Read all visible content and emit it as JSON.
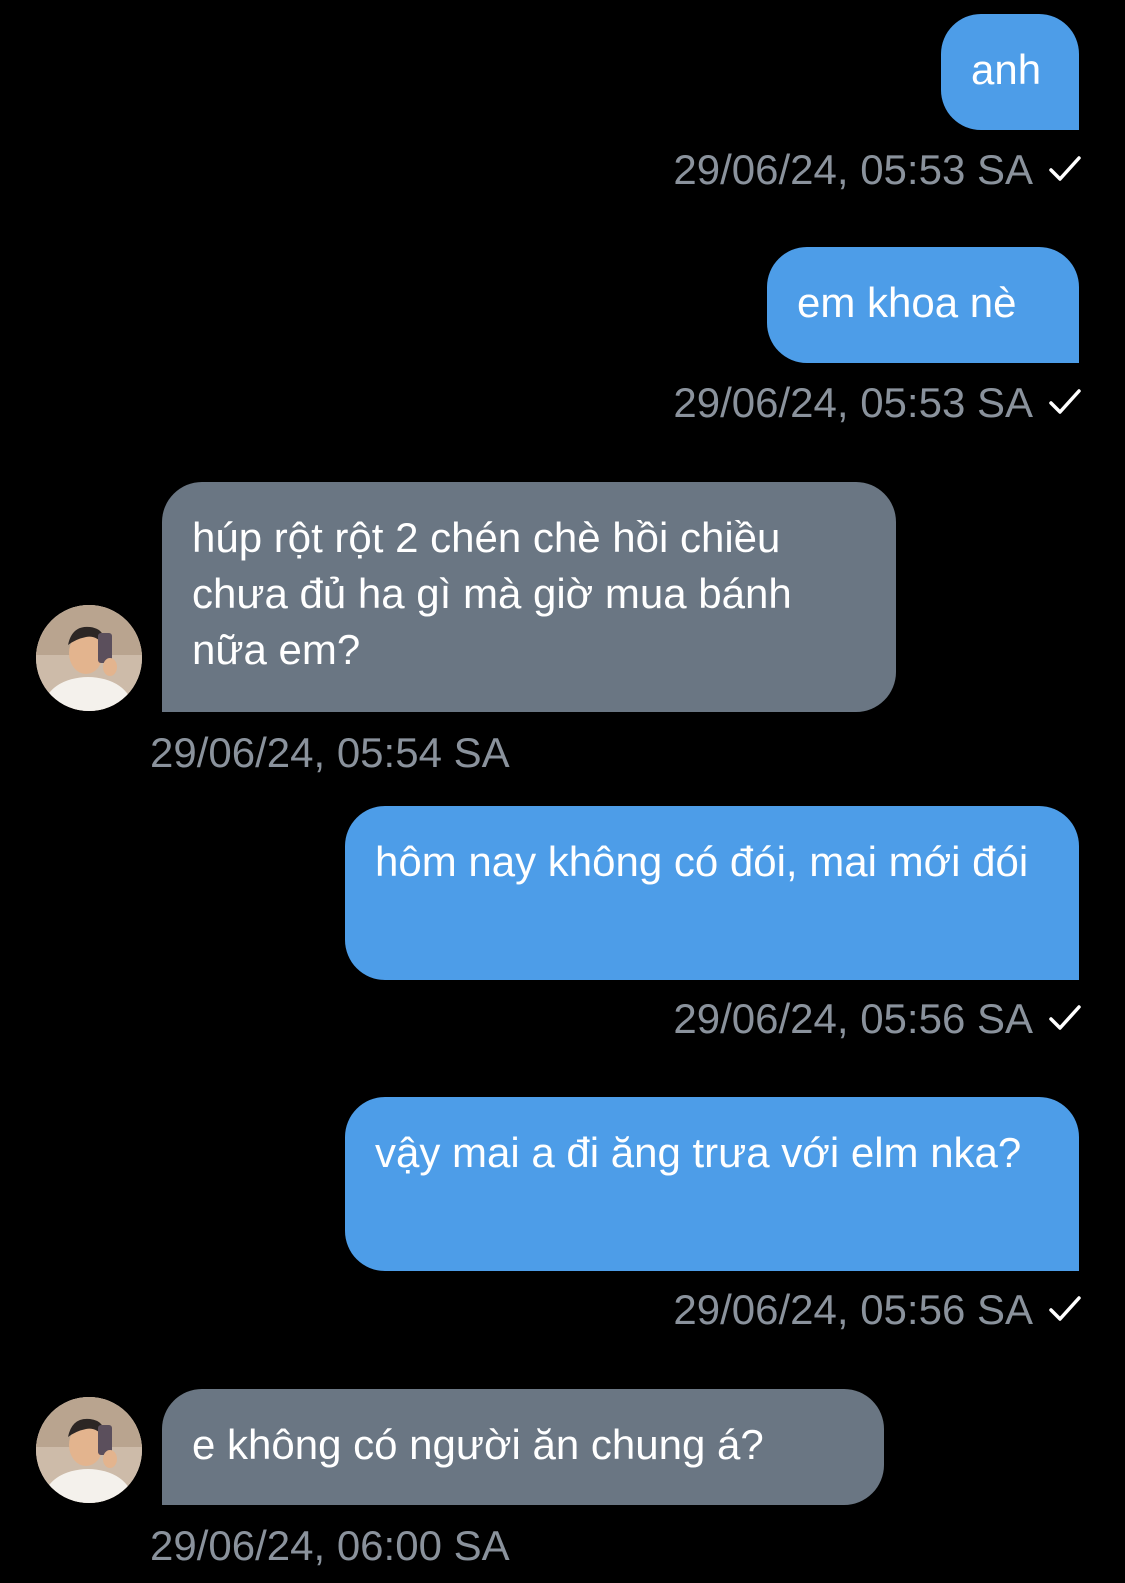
{
  "messages": [
    {
      "direction": "out",
      "text": "anh",
      "time": "29/06/24, 05:53 SA",
      "status_icon": "check-icon"
    },
    {
      "direction": "out",
      "text": "em khoa nè",
      "time": "29/06/24, 05:53 SA",
      "status_icon": "check-icon"
    },
    {
      "direction": "in",
      "text": "húp rột rột 2 chén chè hồi chiều chưa đủ ha gì mà giờ mua bánh nữa em?",
      "time": "29/06/24, 05:54 SA",
      "avatar_icon": "contact-avatar"
    },
    {
      "direction": "out",
      "text": "hôm nay không có đói, mai mới đói",
      "time": "29/06/24, 05:56 SA",
      "status_icon": "check-icon"
    },
    {
      "direction": "out",
      "text": "vậy mai a đi ăng trưa với elm nka?",
      "time": "29/06/24, 05:56 SA",
      "status_icon": "check-icon"
    },
    {
      "direction": "in",
      "text": "e không có người ăn chung á?",
      "time": "29/06/24, 06:00 SA",
      "avatar_icon": "contact-avatar"
    }
  ],
  "colors": {
    "background": "#000000",
    "outgoing_bubble": "#4d9de8",
    "incoming_bubble": "#6a7683",
    "timestamp": "#8a929c",
    "text": "#ffffff"
  }
}
